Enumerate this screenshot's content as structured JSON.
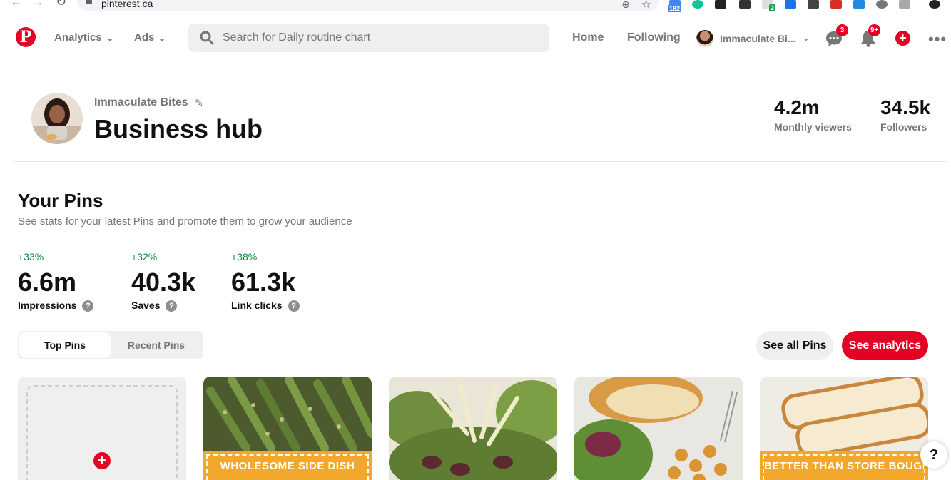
{
  "browser": {
    "url": "pinterest.ca",
    "extension_badges": [
      "182",
      "2"
    ]
  },
  "header": {
    "logo_letter": "P",
    "nav": [
      {
        "label": "Analytics"
      },
      {
        "label": "Ads"
      }
    ],
    "search_placeholder": "Search for Daily routine chart",
    "links": [
      {
        "label": "Home"
      },
      {
        "label": "Following"
      }
    ],
    "profile_name": "Immaculate Bi...",
    "messages_badge": "3",
    "notifications_badge": "9+",
    "create_label": "+",
    "more_label": "•••",
    "brand_color": "#e60023"
  },
  "hub": {
    "account_name": "Immaculate Bites",
    "title": "Business hub",
    "stats": [
      {
        "value": "4.2m",
        "label": "Monthly viewers"
      },
      {
        "value": "34.5k",
        "label": "Followers"
      }
    ]
  },
  "pins_section": {
    "title": "Your Pins",
    "subtitle": "See stats for your latest Pins and promote them to grow your audience",
    "metrics": [
      {
        "delta": "+33%",
        "value": "6.6m",
        "label": "Impressions"
      },
      {
        "delta": "+32%",
        "value": "40.3k",
        "label": "Saves"
      },
      {
        "delta": "+38%",
        "value": "61.3k",
        "label": "Link clicks"
      }
    ],
    "help_glyph": "?",
    "tabs": [
      {
        "label": "Top Pins",
        "active": true
      },
      {
        "label": "Recent Pins",
        "active": false
      }
    ],
    "see_all_label": "See all Pins",
    "analytics_label": "See analytics",
    "cards": [
      {
        "kind": "create",
        "icon": "plus-icon"
      },
      {
        "kind": "pin",
        "banner": "WHOLESOME SIDE DISH",
        "image": "asparagus"
      },
      {
        "kind": "pin",
        "banner": "",
        "image": "salad"
      },
      {
        "kind": "pin",
        "banner": "",
        "image": "sandwich"
      },
      {
        "kind": "pin",
        "banner": "BETTER THAN STORE BOUGHT",
        "image": "bread"
      }
    ]
  },
  "floating_help": "?"
}
